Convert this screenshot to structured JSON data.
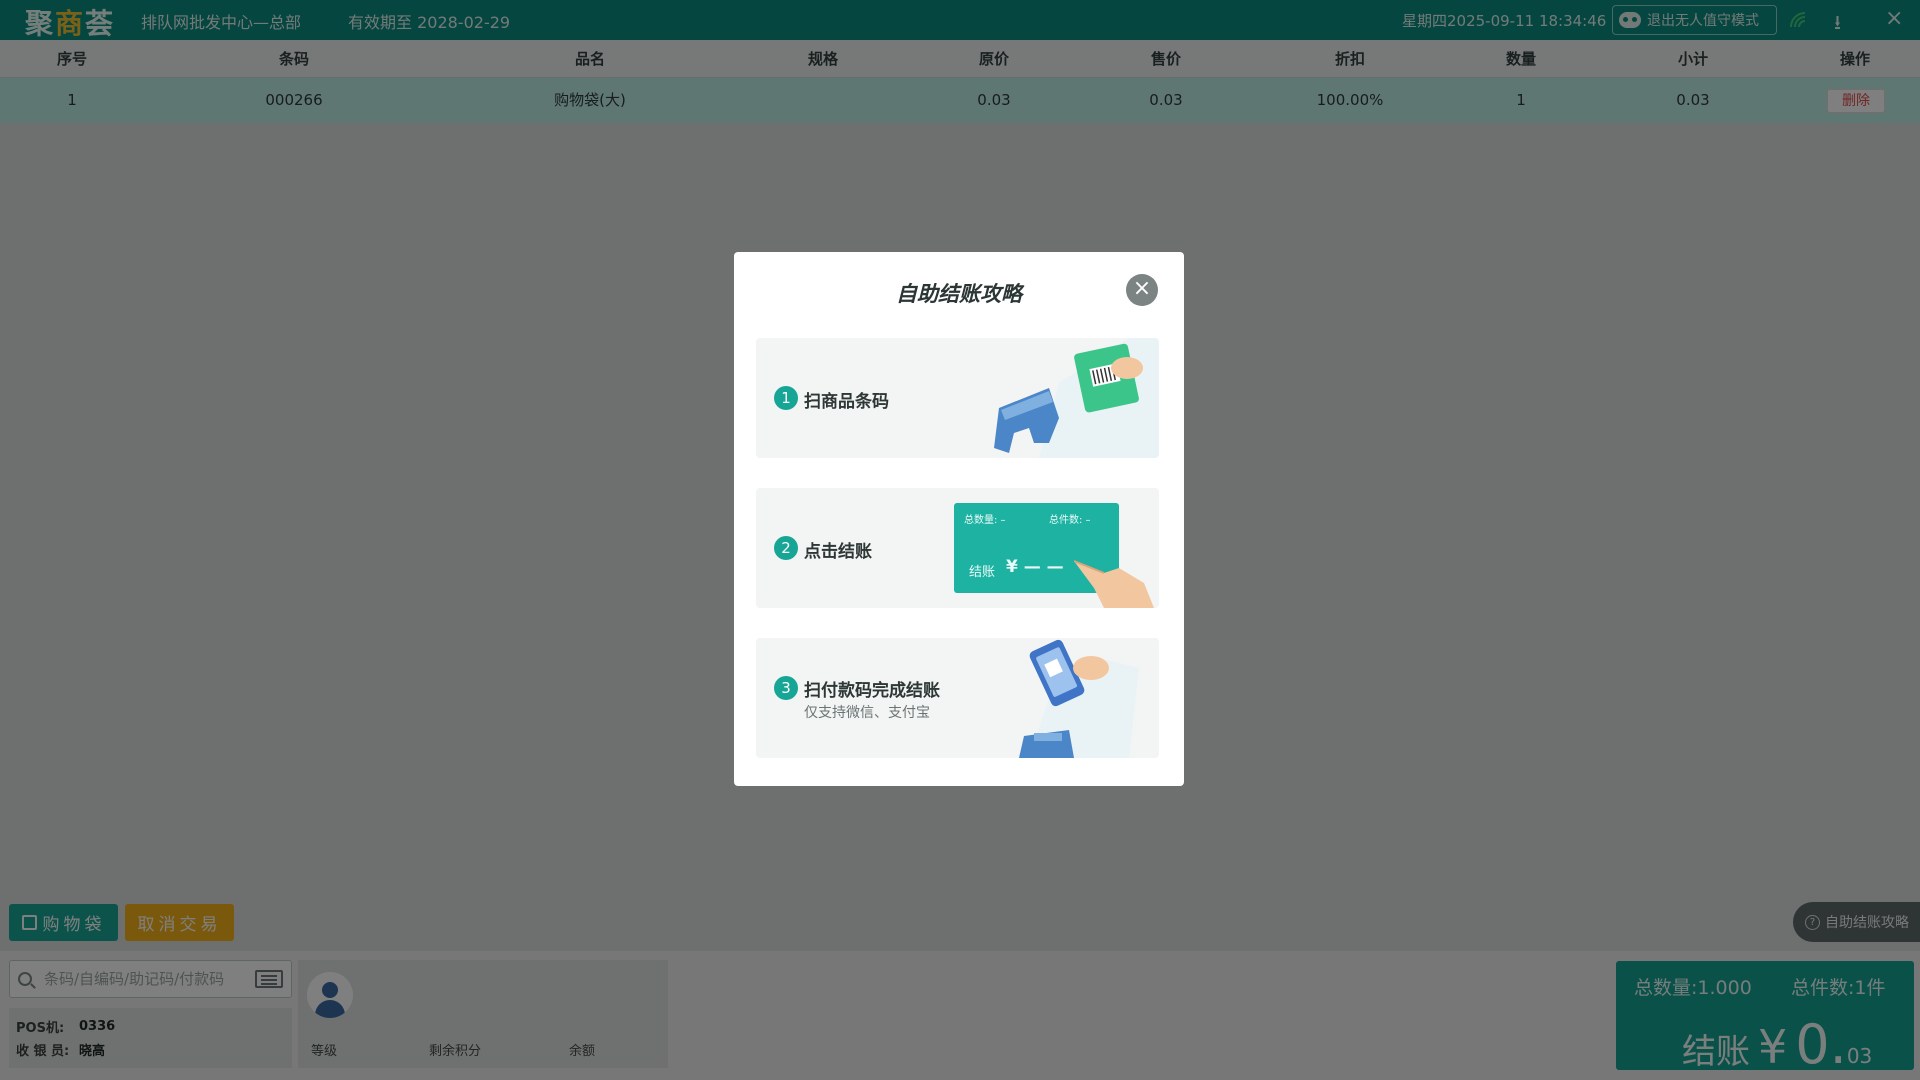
{
  "topbar": {
    "logo_a": "聚",
    "logo_b": "商",
    "logo_c": "荟",
    "store": "排队网批发中心—总部",
    "expiry": "有效期至 2028-02-29",
    "datetime": "星期四2025-09-11 18:34:46",
    "exit_label": "退出无人值守模式"
  },
  "table": {
    "headers": [
      "序号",
      "条码",
      "品名",
      "规格",
      "原价",
      "售价",
      "折扣",
      "数量",
      "小计",
      "操作"
    ],
    "rows": [
      {
        "index": "1",
        "barcode": "000266",
        "name": "购物袋(大)",
        "spec": "",
        "original": "0.03",
        "price": "0.03",
        "discount": "100.00%",
        "qty": "1",
        "subtotal": "0.03",
        "action": "删除"
      }
    ]
  },
  "actions": {
    "bag": "购物袋",
    "cancel": "取消交易",
    "help": "自助结账攻略"
  },
  "search": {
    "placeholder": "条码/自编码/助记码/付款码"
  },
  "pos": {
    "pos_label": "POS机:",
    "pos_value": "0336",
    "cashier_label": "收 银 员:",
    "cashier_value": "晓高"
  },
  "member": {
    "level": "等级",
    "points": "剩余积分",
    "balance": "余额"
  },
  "checkout": {
    "total_qty": "总数量:1.000",
    "total_pieces": "总件数:1件",
    "label": "结账",
    "currency": "¥",
    "amount_int": "0.",
    "amount_dec": "03"
  },
  "modal": {
    "title": "自助结账攻略",
    "close": "×",
    "steps": [
      {
        "num": "1",
        "label": "扫商品条码",
        "sub": ""
      },
      {
        "num": "2",
        "label": "点击结账",
        "sub": ""
      },
      {
        "num": "3",
        "label": "扫付款码完成结账",
        "sub": "仅支持微信、支付宝"
      }
    ],
    "mini_pay": {
      "qty": "总数量: –",
      "pieces": "总件数: –",
      "label": "结账",
      "amount": "¥ — —"
    }
  },
  "colors": {
    "brand": "#0b8c80",
    "accent": "#17a596",
    "warning": "#f5b21a",
    "danger": "#e34a4a"
  }
}
